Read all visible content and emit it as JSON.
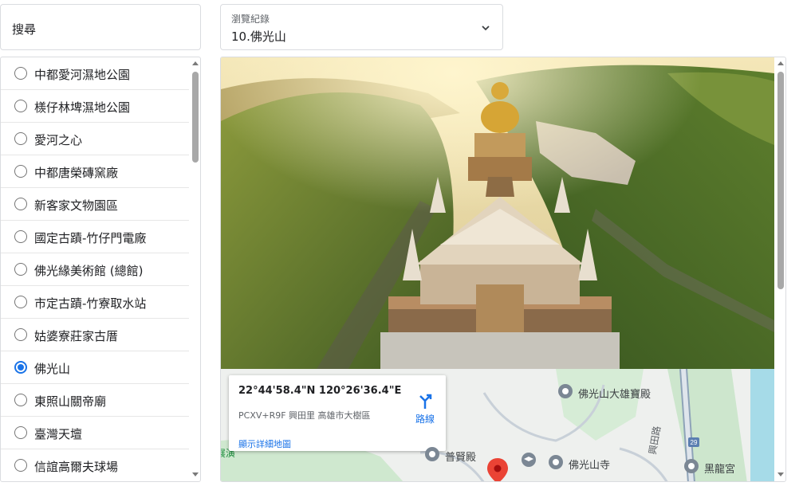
{
  "search": {
    "label": "搜尋"
  },
  "history": {
    "label": "瀏覽紀錄",
    "value": "10.佛光山"
  },
  "places": [
    {
      "label": "中都愛河濕地公園",
      "checked": false
    },
    {
      "label": "檨仔林埤濕地公園",
      "checked": false
    },
    {
      "label": "愛河之心",
      "checked": false
    },
    {
      "label": "中都唐榮磚窯廠",
      "checked": false
    },
    {
      "label": "新客家文物園區",
      "checked": false
    },
    {
      "label": "國定古蹟-竹仔門電廠",
      "checked": false
    },
    {
      "label": "佛光緣美術館 (總館)",
      "checked": false
    },
    {
      "label": "市定古蹟-竹寮取水站",
      "checked": false
    },
    {
      "label": "姑婆寮莊家古厝",
      "checked": false
    },
    {
      "label": "佛光山",
      "checked": true
    },
    {
      "label": "東照山關帝廟",
      "checked": false
    },
    {
      "label": "臺灣天壇",
      "checked": false
    },
    {
      "label": "信誼高爾夫球場",
      "checked": false
    }
  ],
  "map": {
    "coords": "22°44'58.4\"N 120°26'36.4\"E",
    "address": "PCXV+R9F 興田里 高雄市大樹區",
    "directions_label": "路線",
    "detail_link": "顯示詳細地圖",
    "pois": {
      "main_hall": "佛光山大雄寶殿",
      "puxian_hall": "普賢殿",
      "temple": "佛光山寺",
      "heilong": "黑龍宮",
      "road": "興田路",
      "route_no": "29",
      "partial": "展演"
    }
  },
  "colors": {
    "accent": "#1a73e8",
    "pin": "#ea4335"
  }
}
